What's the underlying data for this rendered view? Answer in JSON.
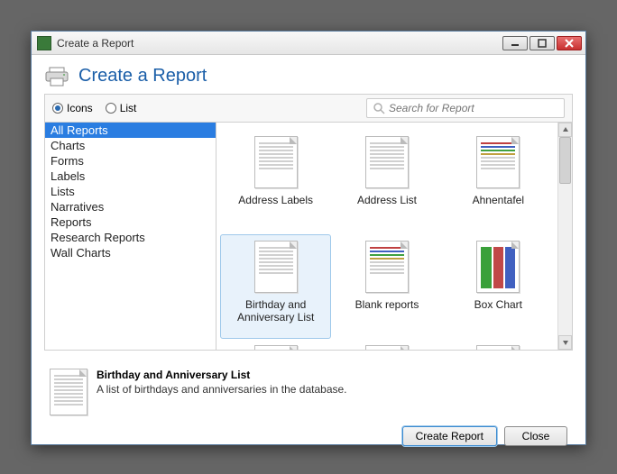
{
  "window": {
    "title": "Create a Report"
  },
  "header": {
    "title": "Create a Report"
  },
  "view_toggle": {
    "icons": "Icons",
    "list": "List",
    "selected": "icons"
  },
  "search": {
    "placeholder": "Search for Report"
  },
  "sidebar": {
    "items": [
      "All Reports",
      "Charts",
      "Forms",
      "Labels",
      "Lists",
      "Narratives",
      "Reports",
      "Research Reports",
      "Wall Charts"
    ],
    "selected_index": 0
  },
  "reports": {
    "items": [
      {
        "label": "Address Labels",
        "kind": "plain"
      },
      {
        "label": "Address List",
        "kind": "plain"
      },
      {
        "label": "Ahnentafel",
        "kind": "colorful"
      },
      {
        "label": "Birthday and Anniversary List",
        "kind": "plain",
        "selected": true
      },
      {
        "label": "Blank reports",
        "kind": "colorful"
      },
      {
        "label": "Box Chart",
        "kind": "boxchart"
      },
      {
        "label": "",
        "kind": "plain"
      },
      {
        "label": "",
        "kind": "plain"
      },
      {
        "label": "",
        "kind": "plain"
      }
    ]
  },
  "details": {
    "title": "Birthday and Anniversary List",
    "description": "A list of birthdays and anniversaries in the database."
  },
  "buttons": {
    "create": "Create Report",
    "close": "Close"
  }
}
